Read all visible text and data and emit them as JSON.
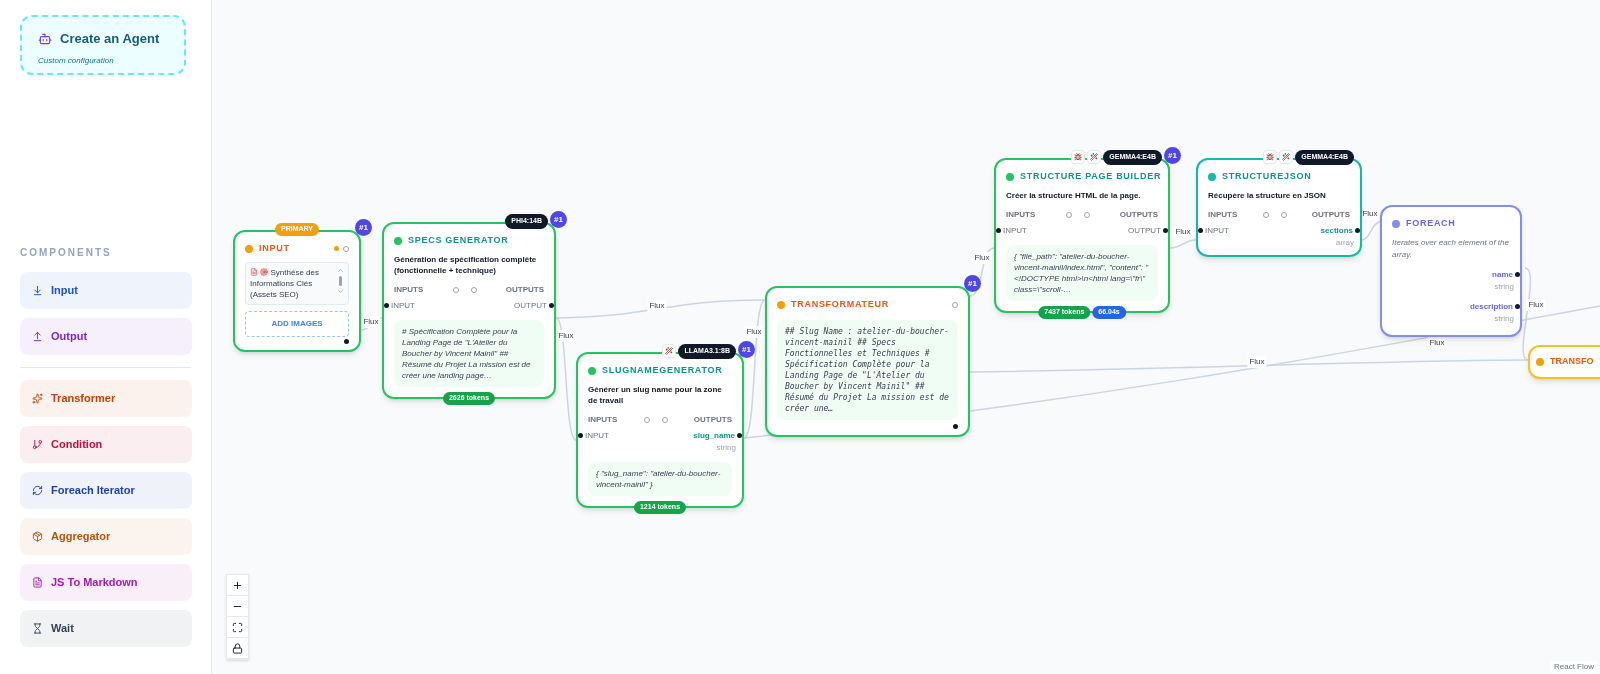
{
  "sidebar": {
    "create_agent": {
      "title": "Create an Agent",
      "subtitle": "Custom configuration"
    },
    "components_heading": "COMPONENTS",
    "component_groups": [
      [
        {
          "label": "Input",
          "color": "#1d4ed8"
        },
        {
          "label": "Output",
          "color": "#7e22ce"
        }
      ],
      [
        {
          "label": "Transformer",
          "color": "#c2410c"
        },
        {
          "label": "Condition",
          "color": "#be123c"
        },
        {
          "label": "Foreach Iterator",
          "color": "#1e40af"
        },
        {
          "label": "Aggregator",
          "color": "#b45309"
        },
        {
          "label": "JS To Markdown",
          "color": "#a21caf"
        },
        {
          "label": "Wait",
          "color": "#334155"
        }
      ]
    ]
  },
  "nodes": [
    {
      "kind": "input",
      "title": "INPUT",
      "color": "#22c55e",
      "badge": "PRIMARY",
      "number": "#1",
      "text": "Synthèse des Informations Clés (Assets SEO)",
      "button": "ADD IMAGES"
    },
    {
      "kind": "llm",
      "title": "SPECS GENERATOR",
      "color": "#22c55e",
      "model": "PHI4:14B",
      "number": "#1",
      "description": "Génération de spécification complète (fonctionnelle + technique)",
      "inputs_label": "INPUTS",
      "outputs_label": "OUTPUTS",
      "inputs": [
        {
          "name": "INPUT"
        }
      ],
      "outputs": [
        {
          "name": "OUTPUT"
        }
      ],
      "preview": "# Spécification Complète pour la Landing Page de \"L'Atelier du Boucher by Vincent Mainil\" ## Résumé du Projet La mission est de créer une landing page…",
      "badges": [
        {
          "text": "2626 tokens",
          "color": "#16a34a"
        }
      ]
    },
    {
      "kind": "llm",
      "title": "SLUGNAMEGENERATOR",
      "color": "#22c55e",
      "tools": [
        {
          "kind": "wand"
        }
      ],
      "model": "LLAMA3.1:8B",
      "number": "#1",
      "description": "Générer un slug name pour la zone de travail",
      "inputs_label": "INPUTS",
      "outputs_label": "OUTPUTS",
      "inputs": [
        {
          "name": "INPUT"
        }
      ],
      "outputs": [
        {
          "name": "slug_name",
          "type": "string"
        }
      ],
      "preview": "{ \"slug_name\": \"atelier-du-boucher-vincent-mainil\" }",
      "badges": [
        {
          "text": "1214 tokens",
          "color": "#16a34a"
        }
      ]
    },
    {
      "kind": "transformer",
      "title": "TRANSFORMATEUR",
      "color": "#22c55e",
      "number": "#1",
      "preview": "## Slug Name : atelier-du-boucher-vincent-mainil ## Specs Fonctionnelles et Techniques # Spécification Complète pour la Landing Page de \"L'Atelier du Boucher by Vincent Mainil\" ## Résumé du Projet La mission est de créer une…"
    },
    {
      "kind": "llm",
      "title": "STRUCTURE PAGE BUILDER",
      "color": "#22c55e",
      "tools": [
        {
          "kind": "bug"
        },
        {
          "kind": "wand"
        }
      ],
      "model": "GEMMA4:E4B",
      "number": "#1",
      "description": "Créer la structure HTML de la page.",
      "inputs_label": "INPUTS",
      "outputs_label": "OUTPUTS",
      "inputs": [
        {
          "name": "INPUT"
        }
      ],
      "outputs": [
        {
          "name": "OUTPUT"
        }
      ],
      "preview": "{ \"file_path\": \"atelier-du-boucher-vincent-mainil/index.html\", \"content\": \"<!DOCTYPE html>\\n<html lang=\\\"fr\\\" class=\\\"scroll-…",
      "badges": [
        {
          "text": "7437 tokens",
          "color": "#16a34a"
        },
        {
          "text": "66.04s",
          "color": "#2563eb"
        }
      ]
    },
    {
      "kind": "llm",
      "title": "STRUCTUREJSON",
      "color": "#14b8a6",
      "tools": [
        {
          "kind": "bug"
        },
        {
          "kind": "wand"
        }
      ],
      "model": "GEMMA4:E4B",
      "description": "Récupère la structure en JSON",
      "inputs_label": "INPUTS",
      "outputs_label": "OUTPUTS",
      "inputs": [
        {
          "name": "INPUT"
        }
      ],
      "outputs": [
        {
          "name": "sections",
          "type": "array"
        }
      ]
    },
    {
      "kind": "foreach",
      "title": "FOREACH",
      "color": "#818cf8",
      "description": "Iterates over each element of the array.",
      "outputs": [
        {
          "name": "name",
          "type": "string"
        },
        {
          "name": "description",
          "type": "string"
        }
      ]
    },
    {
      "kind": "transformer",
      "title": "TRANSFO",
      "color": "#fbbf24"
    }
  ],
  "edges": [
    {
      "label": "Flux"
    },
    {
      "label": "Flux"
    },
    {
      "label": "Flux"
    },
    {
      "label": "Flux"
    },
    {
      "label": "Flux"
    },
    {
      "label": "Flux"
    },
    {
      "label": "Flux"
    },
    {
      "label": "Flux"
    },
    {
      "label": "Flux"
    },
    {
      "label": "Flux"
    }
  ],
  "attribution": "React Flow"
}
